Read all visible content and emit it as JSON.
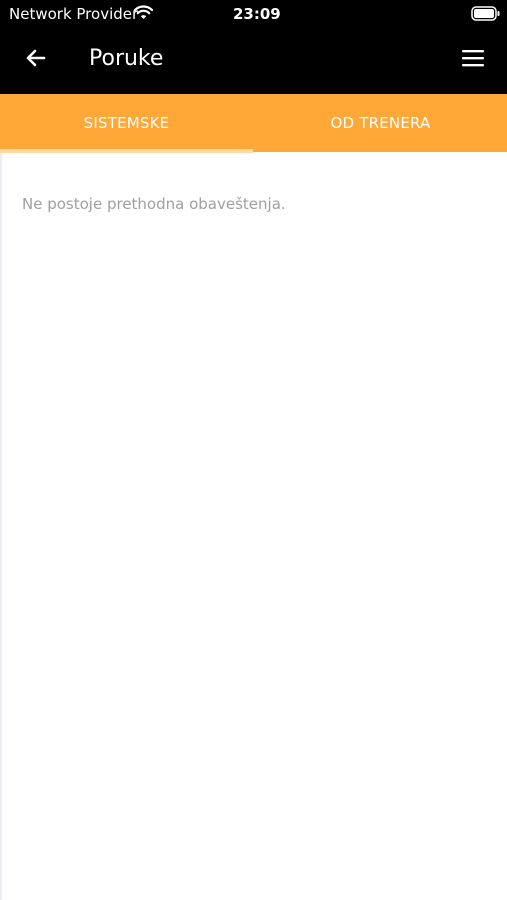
{
  "status_bar": {
    "carrier": "Network Provider",
    "time": "23:09",
    "wifi_icon": "wifi-icon",
    "battery_icon": "battery-icon"
  },
  "app_bar": {
    "title": "Poruke",
    "back_icon": "arrow-left-icon",
    "menu_icon": "hamburger-menu-icon"
  },
  "tabs": [
    {
      "label": "SISTEMSKE",
      "selected": true
    },
    {
      "label": "OD TRENERA",
      "selected": false
    }
  ],
  "content": {
    "empty_message": "Ne postoje prethodna obaveštenja."
  },
  "colors": {
    "header_background": "#000000",
    "tab_background": "#ffa737",
    "tab_indicator": "#ffd8a6",
    "empty_text": "#a0a0a0"
  }
}
